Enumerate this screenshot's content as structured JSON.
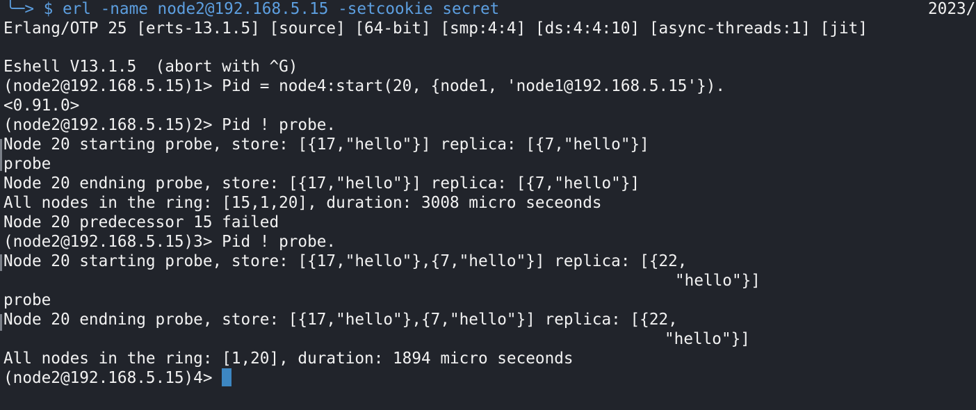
{
  "prompt_command": "╰─> $ erl -name node2@192.168.5.15 -setcookie secret",
  "date_fragment": "2023/",
  "lines": [
    "Erlang/OTP 25 [erts-13.1.5] [source] [64-bit] [smp:4:4] [ds:4:4:10] [async-threads:1] [jit]",
    "",
    "Eshell V13.1.5  (abort with ^G)",
    "(node2@192.168.5.15)1> Pid = node4:start(20, {node1, 'node1@192.168.5.15'}).",
    "<0.91.0>",
    "(node2@192.168.5.15)2> Pid ! probe.",
    "Node 20 starting probe, store: [{17,\"hello\"}] replica: [{7,\"hello\"}]",
    "probe",
    "Node 20 endning probe, store: [{17,\"hello\"}] replica: [{7,\"hello\"}]",
    "All nodes in the ring: [15,1,20], duration: 3008 micro seceonds",
    "Node 20 predecessor 15 failed",
    "(node2@192.168.5.15)3> Pid ! probe.",
    "Node 20 starting probe, store: [{17,\"hello\"},{7,\"hello\"}] replica: [{22,",
    "\"hello\"}]",
    "probe",
    "Node 20 endning probe, store: [{17,\"hello\"},{7,\"hello\"}] replica: [{22,",
    "\"hello\"}]",
    "All nodes in the ring: [1,20], duration: 1894 micro seceonds",
    "(node2@192.168.5.15)4> "
  ]
}
